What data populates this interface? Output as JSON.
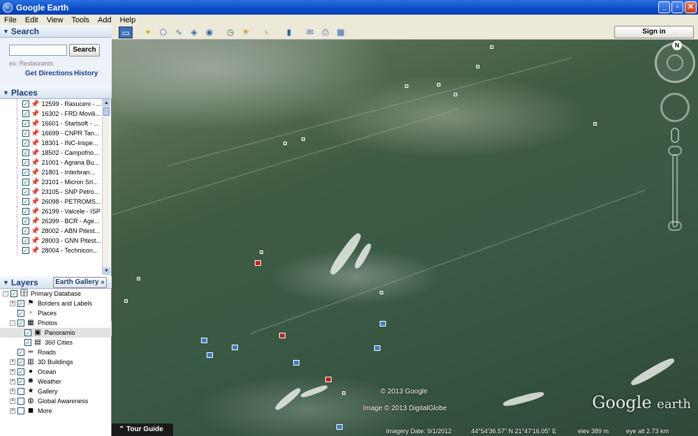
{
  "window": {
    "title": "Google Earth"
  },
  "menu": [
    "File",
    "Edit",
    "View",
    "Tools",
    "Add",
    "Help"
  ],
  "search": {
    "title": "Search",
    "input_value": "",
    "button": "Search",
    "hint": "ex: Restaurants",
    "get_directions": "Get Directions",
    "history": "History"
  },
  "places": {
    "title": "Places",
    "items": [
      "12599 - Rasuceni - ...",
      "16302 - FRD Movili...",
      "16601 - Startsoft - ...",
      "16699 - CNPR Tan...",
      "18301 - INC-Inspe...",
      "18502 - Campofrio...",
      "21001 - Agrana Bu...",
      "21801 - Interbran...",
      "23101 - Micron Srl...",
      "23105 - SNP Petro...",
      "26098 - PETROMS...",
      "26199 - Valcele - ISP",
      "26399 - BCR - Age...",
      "28002 - ABN Pitest...",
      "28003 - GNN Pitest...",
      "28004 - Technicon..."
    ]
  },
  "layers": {
    "title": "Layers",
    "earth_gallery": "Earth Gallery",
    "items": [
      {
        "label": "Primary Database",
        "icon": "database-icon"
      },
      {
        "label": "Borders and Labels",
        "icon": "borders-icon"
      },
      {
        "label": "Places",
        "icon": "places-icon"
      },
      {
        "label": "Photos",
        "icon": "photos-icon"
      },
      {
        "label": "Panoramio",
        "icon": "panoramio-icon"
      },
      {
        "label": "360 Cities",
        "icon": "cities360-icon"
      },
      {
        "label": "Roads",
        "icon": "roads-icon"
      },
      {
        "label": "3D Buildings",
        "icon": "buildings-icon"
      },
      {
        "label": "Ocean",
        "icon": "ocean-icon"
      },
      {
        "label": "Weather",
        "icon": "weather-icon"
      },
      {
        "label": "Gallery",
        "icon": "gallery-icon"
      },
      {
        "label": "Global Awareness",
        "icon": "global-awareness-icon"
      },
      {
        "label": "More",
        "icon": "more-icon"
      }
    ]
  },
  "toolbar": {
    "sign_in": "Sign in"
  },
  "map": {
    "compass_n": "N",
    "copyright_google": "© 2013 Google",
    "copyright_image": "Image © 2013 DigitalGlobe",
    "logo_google": "Google",
    "logo_earth": "earth",
    "tour_guide": "Tour Guide",
    "imagery_date": "Imagery Date: 9/1/2012",
    "coordinates": "44°54'36.57\" N   21°47'16.05\" E",
    "elevation": "elev  389 m",
    "eye_alt": "eye alt  2.73 km"
  }
}
